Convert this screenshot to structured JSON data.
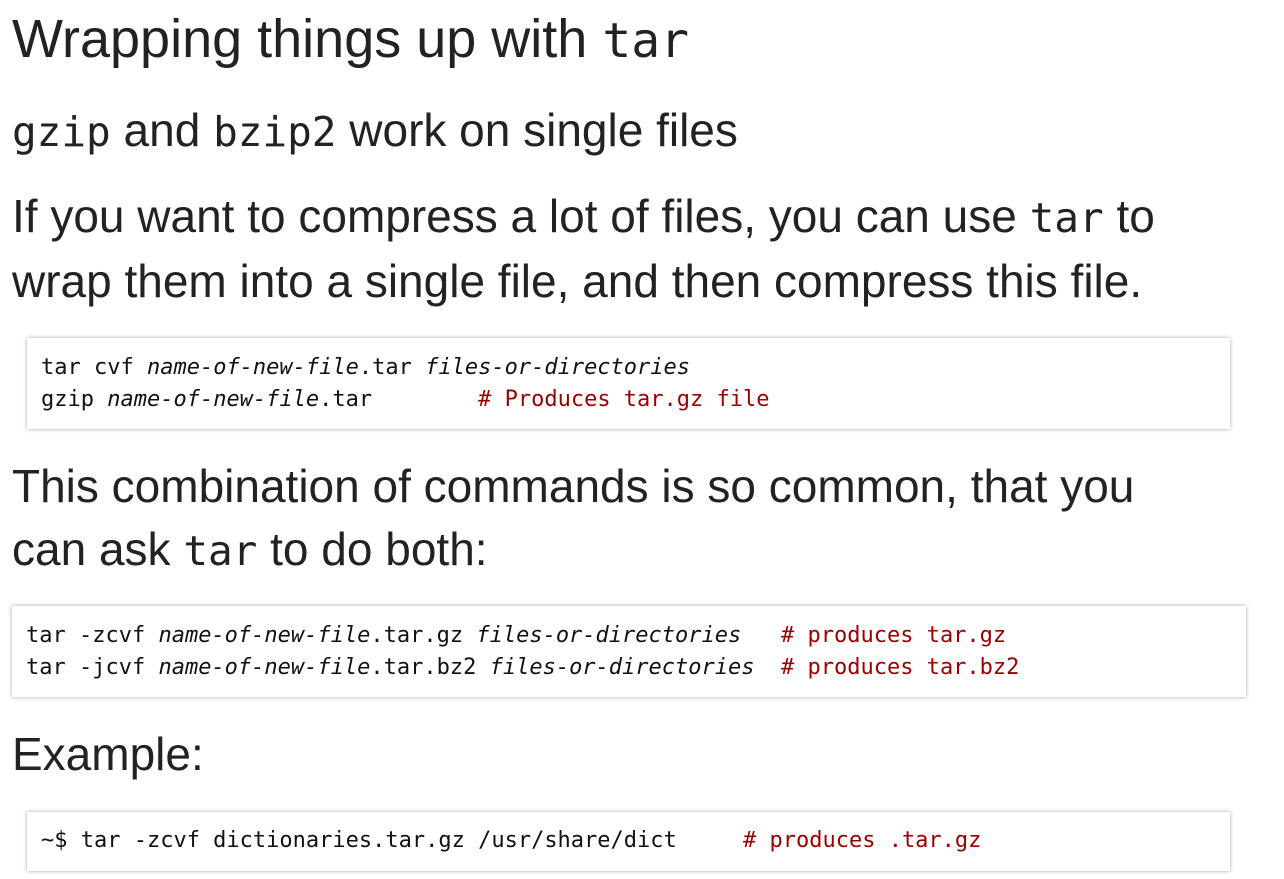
{
  "title": {
    "text": "Wrapping things up with ",
    "code": "tar"
  },
  "paragraphs": {
    "gzip": {
      "code1": "gzip",
      "text1": " and ",
      "code2": "bzip2",
      "text2": " work on single files"
    },
    "compress": {
      "line1_text": "If you want to compress a lot of files, you can use ",
      "line1_code": "tar",
      "line1_end": " to",
      "line2_text": "wrap them into a single file, and then compress this file."
    },
    "combo": {
      "line1_text": "This combination of commands is so common, that you",
      "line2_text": "can ask ",
      "line2_code": "tar",
      "line2_end": " to do both:"
    },
    "example": {
      "text": "Example:"
    }
  },
  "code_blocks": {
    "basic": {
      "line1": {
        "cmd": "tar cvf ",
        "arg1": "name-of-new-file",
        "ext": ".tar ",
        "arg2": "files-or-directories"
      },
      "line2": {
        "cmd": "gzip ",
        "arg1": "name-of-new-file",
        "ext": ".tar",
        "pad": "        ",
        "comment": "# Produces tar.gz file"
      }
    },
    "combined": {
      "line1": {
        "cmd": "tar -zcvf ",
        "arg1": "name-of-new-file",
        "ext": ".tar.gz ",
        "arg2": "files-or-directories",
        "pad": "   ",
        "comment": "# produces tar.gz"
      },
      "line2": {
        "cmd": "tar -jcvf ",
        "arg1": "name-of-new-file",
        "ext": ".tar.bz2 ",
        "arg2": "files-or-directories",
        "pad": "  ",
        "comment": "# produces tar.bz2"
      }
    },
    "example": {
      "line1": {
        "cmd": "~$ tar -zcvf dictionaries.tar.gz /usr/share/dict",
        "pad": "     ",
        "comment": "# produces .tar.gz"
      }
    }
  },
  "colors": {
    "text": "#222222",
    "comment": "#990000",
    "background": "#ffffff"
  }
}
